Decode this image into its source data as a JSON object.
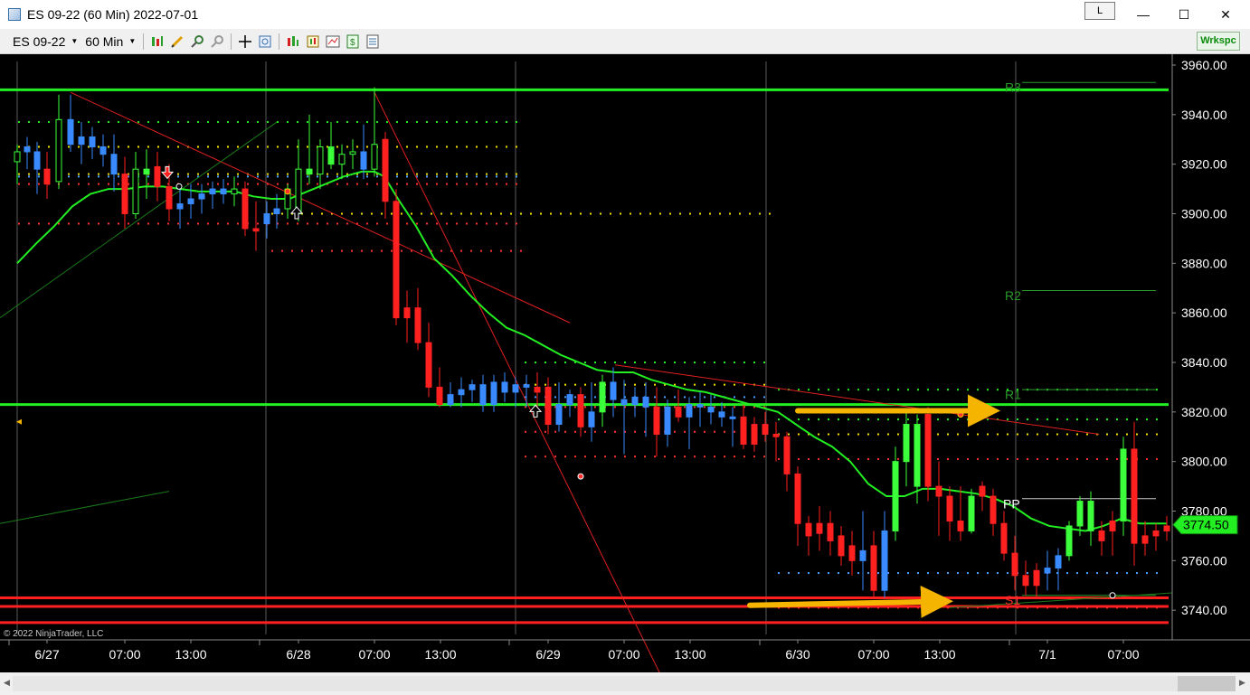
{
  "window": {
    "title": "ES 09-22 (60 Min)  2022-07-01",
    "link_button": "L",
    "minimize": "—",
    "maximize": "☐",
    "close": "✕"
  },
  "toolbar": {
    "instrument": "ES 09-22",
    "interval": "60 Min",
    "workspace_button": "Wrkspc",
    "icons": [
      "bar-type-icon",
      "drawing-tools-icon",
      "zoom-in-icon",
      "zoom-out-icon",
      "crosshair-icon",
      "data-box-icon",
      "indicators-icon",
      "strategies-icon",
      "chart-style-icon",
      "properties-icon",
      "templates-icon"
    ]
  },
  "chart": {
    "copyright": "© 2022 NinjaTrader, LLC",
    "price_labels": [
      "3960.00",
      "3940.00",
      "3920.00",
      "3900.00",
      "3880.00",
      "3860.00",
      "3840.00",
      "3820.00",
      "3800.00",
      "3780.00",
      "3760.00",
      "3740.00"
    ],
    "current_price": "3774.50",
    "pivot_labels": [
      "R3",
      "R2",
      "R1",
      "PP",
      "S1"
    ],
    "time_labels": [
      "6/27",
      "07:00",
      "13:00",
      "6/28",
      "07:00",
      "13:00",
      "6/29",
      "07:00",
      "13:00",
      "6/30",
      "07:00",
      "13:00",
      "7/1",
      "07:00"
    ],
    "colors": {
      "up": "#3aff3a",
      "down": "#ff2020",
      "blue": "#3a8aff",
      "ma": "#22ee22",
      "arrow": "#f5b400"
    }
  }
}
